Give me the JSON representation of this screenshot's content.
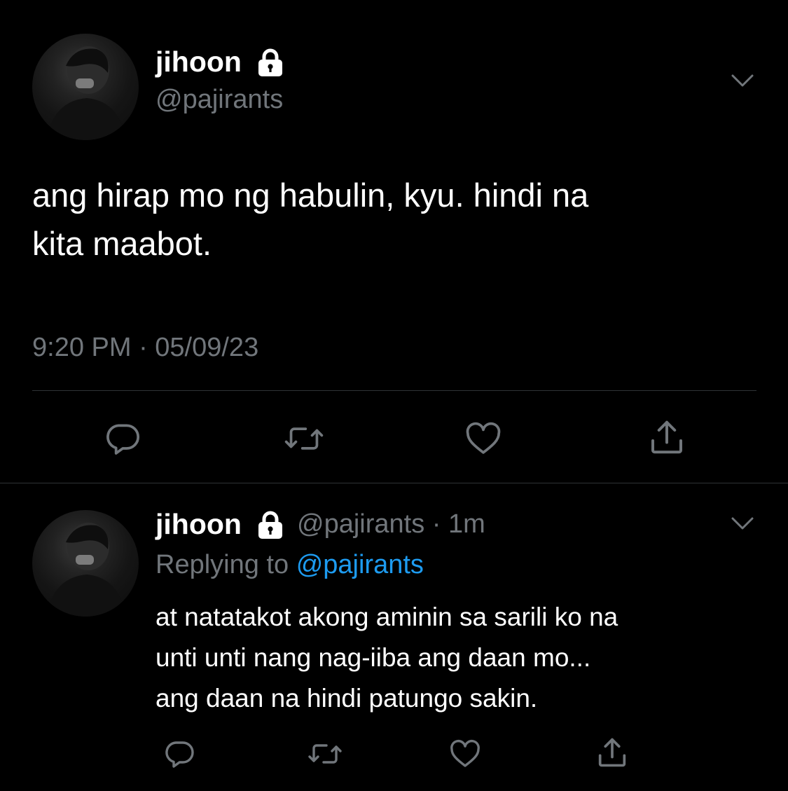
{
  "main_tweet": {
    "author": {
      "name": "jihoon",
      "handle": "@pajirants",
      "protected": true,
      "avatar": "avatar-photo"
    },
    "text_line1": "ang hirap mo ng habulin, kyu. hindi na",
    "text_line2": "kita maabot.",
    "timestamp": "9:20 PM · 05/09/23",
    "more_icon": "chevron-down-icon",
    "actions": [
      "reply-icon",
      "retweet-icon",
      "like-icon",
      "share-icon"
    ]
  },
  "reply_tweet": {
    "author": {
      "name": "jihoon",
      "handle": "@pajirants",
      "protected": true,
      "avatar": "avatar-photo"
    },
    "meta_handle_time": "@pajirants · 1m",
    "replying_label": "Replying to",
    "replying_handle": "@pajirants",
    "text_line1": "at natatakot akong aminin sa sarili ko na",
    "text_line2": "unti unti nang nag-iiba ang daan mo...",
    "text_line3": "ang daan na hindi patungo sakin.",
    "more_icon": "chevron-down-icon",
    "actions": [
      "reply-icon",
      "retweet-icon",
      "like-icon",
      "share-icon"
    ]
  },
  "colors": {
    "background": "#000000",
    "text": "#ffffff",
    "muted": "#71767b",
    "link": "#1d9bf0",
    "divider": "#2f3336"
  }
}
